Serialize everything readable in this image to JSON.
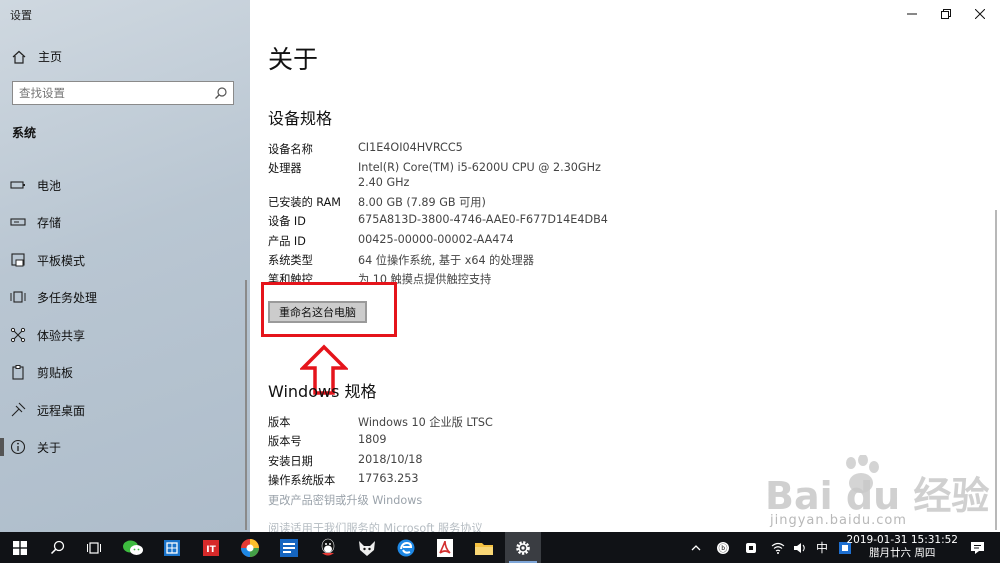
{
  "window": {
    "title": "设置"
  },
  "sidebar": {
    "home_label": "主页",
    "search_placeholder": "查找设置",
    "section_label": "系统",
    "items": [
      {
        "label": "电池",
        "icon": "battery-icon"
      },
      {
        "label": "存储",
        "icon": "storage-icon"
      },
      {
        "label": "平板模式",
        "icon": "tablet-mode-icon"
      },
      {
        "label": "多任务处理",
        "icon": "multitasking-icon"
      },
      {
        "label": "体验共享",
        "icon": "shared-experiences-icon"
      },
      {
        "label": "剪贴板",
        "icon": "clipboard-icon"
      },
      {
        "label": "远程桌面",
        "icon": "remote-desktop-icon"
      },
      {
        "label": "关于",
        "icon": "info-icon",
        "selected": true
      }
    ]
  },
  "main": {
    "title": "关于",
    "device_spec_heading": "设备规格",
    "device_specs": [
      {
        "label": "设备名称",
        "value": "CI1E4OI04HVRCC5"
      },
      {
        "label": "处理器",
        "value": "Intel(R) Core(TM) i5-6200U CPU @ 2.30GHz   2.40 GHz"
      },
      {
        "label": "已安装的 RAM",
        "value": "8.00 GB (7.89 GB 可用)"
      },
      {
        "label": "设备 ID",
        "value": "675A813D-3800-4746-AAE0-F677D14E4DB4"
      },
      {
        "label": "产品 ID",
        "value": "00425-00000-00002-AA474"
      },
      {
        "label": "系统类型",
        "value": "64 位操作系统, 基于 x64 的处理器"
      },
      {
        "label": "笔和触控",
        "value": "为 10 触摸点提供触控支持"
      }
    ],
    "rename_button": "重命名这台电脑",
    "windows_spec_heading": "Windows 规格",
    "windows_specs": [
      {
        "label": "版本",
        "value": "Windows 10 企业版 LTSC"
      },
      {
        "label": "版本号",
        "value": "1809"
      },
      {
        "label": "安装日期",
        "value": "2018/10/18"
      },
      {
        "label": "操作系统版本",
        "value": "17763.253"
      }
    ],
    "change_key_link": "更改产品密钥或升级 Windows",
    "agreement_link": "阅读适用于我们服务的 Microsoft 服务协议"
  },
  "watermark": {
    "brand": "Bai du 经验",
    "url": "jingyan.baidu.com"
  },
  "taskbar": {
    "ime": "中",
    "time": "2019-01-31 15:31:52",
    "date": "腊月廿六 周四",
    "apps": [
      "windows-start-icon",
      "search-icon",
      "task-view-icon",
      "wechat-icon",
      "app-blue-icon",
      "it-app-icon",
      "color-wheel-icon",
      "news-app-icon",
      "qq-icon",
      "fox-app-icon",
      "edge-icon",
      "pdf-icon",
      "file-explorer-icon",
      "settings-gear-icon"
    ]
  },
  "colors": {
    "highlight_red": "#e5141b",
    "taskbar": "#101216",
    "sidebar": "#b9c6d2"
  }
}
